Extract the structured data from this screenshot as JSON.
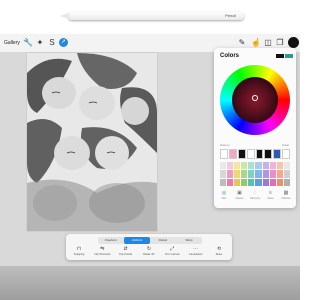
{
  "pencil": {
    "label": "Pencil"
  },
  "toolbar": {
    "gallery_label": "Gallery",
    "left_icons": [
      "wrench-icon",
      "magic-wand-icon",
      "selection-icon",
      "transform-arrow-icon"
    ],
    "right_icons": [
      "brush-icon",
      "smudge-icon",
      "eraser-icon",
      "layers-icon",
      "color-swatch"
    ],
    "active_color": "#111111"
  },
  "colors_panel": {
    "title": "Colors",
    "current_colors": [
      "#111111",
      "#2a9d8f"
    ],
    "history_label": "History",
    "clear_label": "Clear",
    "history": [
      "#ffffff",
      "#f4a6c6",
      "#111111",
      "#ffffff",
      "#111111",
      "#111111",
      "#2a5db0",
      "#ffffff"
    ],
    "palette": [
      "#e9e9e9",
      "#f8c8dc",
      "#f3e6a1",
      "#c9e7a8",
      "#a8e0d4",
      "#a9c9f0",
      "#c7b1ec",
      "#f3b0d8",
      "#f7c4a8",
      "#e7e7e7",
      "#d7d7d7",
      "#f49ac2",
      "#ecd77a",
      "#a9d985",
      "#7fd1c0",
      "#84b3ea",
      "#b095e4",
      "#ee8cc8",
      "#f4aa84",
      "#cfcfcf",
      "#bcbcbc",
      "#ee78ad",
      "#e3c75a",
      "#8ccd66",
      "#58c2ad",
      "#5f9de3",
      "#9a79dc",
      "#e86ab7",
      "#f18f62",
      "#b0b0b0"
    ],
    "tabs": [
      {
        "label": "Disc",
        "icon": "disc-icon"
      },
      {
        "label": "Classic",
        "icon": "square-icon"
      },
      {
        "label": "Harmony",
        "icon": "harmony-icon"
      },
      {
        "label": "Value",
        "icon": "value-icon"
      },
      {
        "label": "Palettes",
        "icon": "palettes-icon"
      }
    ]
  },
  "bottom_panel": {
    "segments": [
      {
        "label": "Freeform"
      },
      {
        "label": "Uniform"
      },
      {
        "label": "Distort"
      },
      {
        "label": "Warp"
      }
    ],
    "tools": [
      {
        "label": "Snapping",
        "icon": "magnet-icon"
      },
      {
        "label": "Flip Horizontal",
        "icon": "flip-h-icon"
      },
      {
        "label": "Flip Vertical",
        "icon": "flip-v-icon"
      },
      {
        "label": "Rotate 45°",
        "icon": "rotate-icon"
      },
      {
        "label": "Fit to Canvas",
        "icon": "fit-canvas-icon"
      },
      {
        "label": "Interpolation",
        "icon": "interpolation-icon"
      },
      {
        "label": "Reset",
        "icon": "reset-icon"
      }
    ]
  }
}
